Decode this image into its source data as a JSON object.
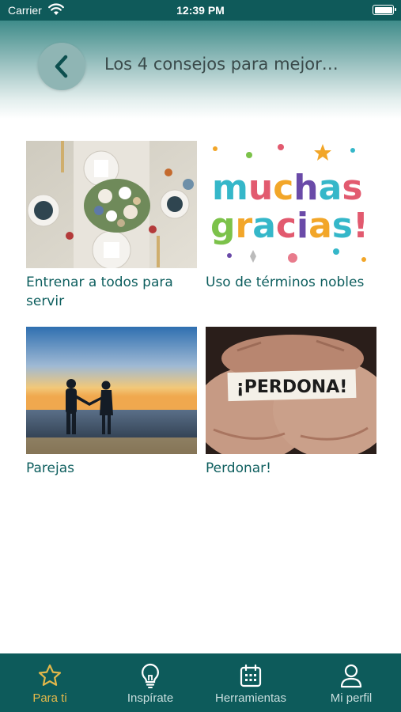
{
  "status_bar": {
    "carrier": "Carrier",
    "time": "12:39 PM"
  },
  "header": {
    "title": "Los 4 consejos para mejor…",
    "back_icon": "chevron-left-icon"
  },
  "cards": [
    {
      "caption": "Entrenar a todos para servir",
      "image": "table-setting-flowers"
    },
    {
      "caption": "Uso de términos nobles",
      "image": "muchas-gracias-lettering",
      "image_text_1": "muchas",
      "image_text_2": "gracias!"
    },
    {
      "caption": "Parejas",
      "image": "couple-beach-sunset"
    },
    {
      "caption": "Perdonar!",
      "image": "hands-perdona-paper",
      "image_text": "¡PERDONA!"
    }
  ],
  "tab_bar": {
    "items": [
      {
        "label": "Para ti",
        "icon": "star-icon",
        "active": true
      },
      {
        "label": "Inspírate",
        "icon": "lightbulb-icon",
        "active": false
      },
      {
        "label": "Herramientas",
        "icon": "calendar-icon",
        "active": false
      },
      {
        "label": "Mi perfil",
        "icon": "user-icon",
        "active": false
      }
    ]
  },
  "colors": {
    "primary": "#0d5b5b",
    "accent": "#e3b84a",
    "caption": "#0d5e5e"
  }
}
